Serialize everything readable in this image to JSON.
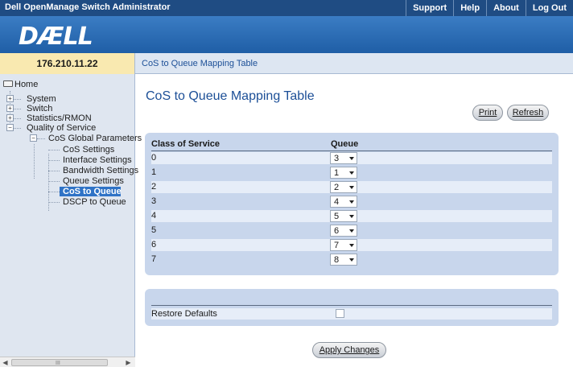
{
  "header": {
    "app_title": "Dell OpenManage Switch Administrator",
    "nav": [
      "Support",
      "Help",
      "About",
      "Log Out"
    ],
    "logo_text": "DÆLL",
    "colors": {
      "topbar": "#1f4c83",
      "logo_band": "#2d6bb1",
      "accent": "#1c4f97"
    }
  },
  "ip_address": "176.210.11.22",
  "breadcrumb": "CoS to Queue Mapping Table",
  "sidebar": {
    "home": "Home",
    "items": {
      "system": "System",
      "switch": "Switch",
      "stats": "Statistics/RMON",
      "qos": "Quality of Service",
      "cos_global": "CoS Global Parameters",
      "cos_settings": "CoS Settings",
      "interface_settings": "Interface Settings",
      "bandwidth_settings": "Bandwidth Settings",
      "queue_settings": "Queue Settings",
      "cos_to_queue": "CoS to Queue",
      "dscp_to_queue": "DSCP to Queue"
    },
    "selected": "CoS to Queue",
    "scrollbar_grip": "III"
  },
  "main": {
    "title": "CoS to Queue Mapping Table",
    "buttons": {
      "print": "Print",
      "refresh": "Refresh",
      "apply": "Apply Changes"
    },
    "table": {
      "headers": {
        "cos": "Class of Service",
        "queue": "Queue"
      },
      "rows": [
        {
          "cos": "0",
          "queue": "3"
        },
        {
          "cos": "1",
          "queue": "1"
        },
        {
          "cos": "2",
          "queue": "2"
        },
        {
          "cos": "3",
          "queue": "4"
        },
        {
          "cos": "4",
          "queue": "5"
        },
        {
          "cos": "5",
          "queue": "6"
        },
        {
          "cos": "6",
          "queue": "7"
        },
        {
          "cos": "7",
          "queue": "8"
        }
      ]
    },
    "restore_defaults": {
      "label": "Restore Defaults",
      "checked": false
    }
  }
}
